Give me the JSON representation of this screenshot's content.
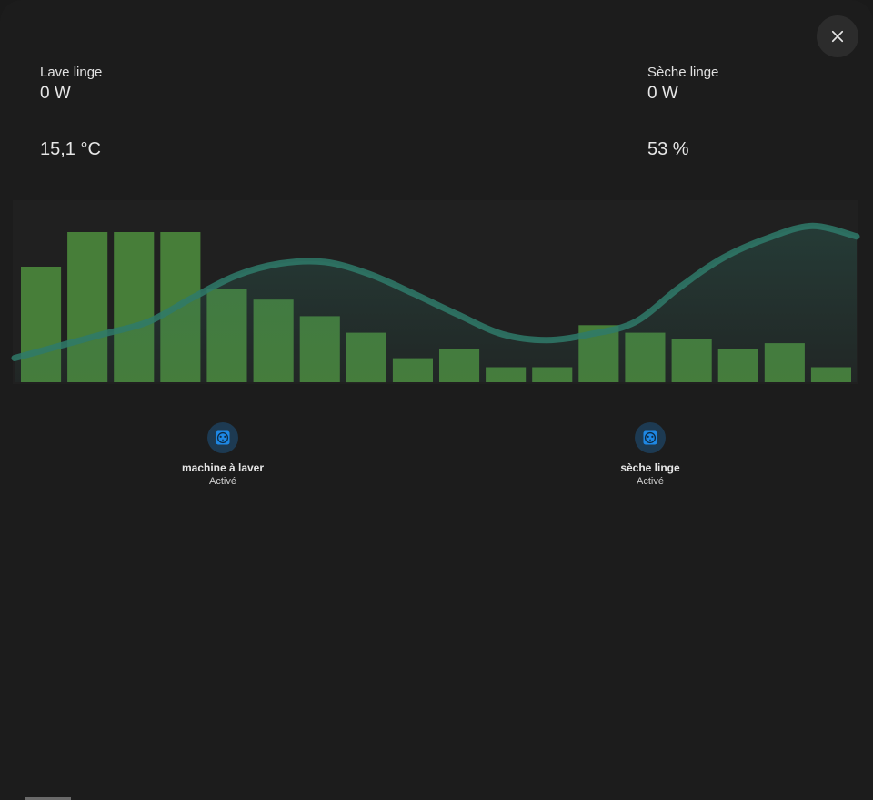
{
  "dialog": {
    "close_icon": "close-icon"
  },
  "sensors": {
    "left": {
      "name": "Lave linge",
      "value": "0 W",
      "secondary": "15,1 °C"
    },
    "right": {
      "name": "Sèche linge",
      "value": "0 W",
      "secondary": "53 %"
    }
  },
  "chart_data": {
    "type": "bar",
    "bar_color": "#4f8f3e",
    "line_color": "#2f7a6a",
    "bars": [
      0.77,
      1.0,
      1.0,
      1.0,
      0.62,
      0.55,
      0.44,
      0.33,
      0.16,
      0.22,
      0.1,
      0.1,
      0.38,
      0.33,
      0.29,
      0.22,
      0.26,
      0.1
    ],
    "line": [
      0.1,
      0.18,
      0.26,
      0.34,
      0.5,
      0.65,
      0.73,
      0.74,
      0.66,
      0.53,
      0.39,
      0.26,
      0.22,
      0.26,
      0.34,
      0.57,
      0.77,
      0.9,
      0.98,
      0.91
    ]
  },
  "devices": [
    {
      "name": "machine à laver",
      "state": "Activé",
      "icon": "power-socket-icon"
    },
    {
      "name": "sèche linge",
      "state": "Activé",
      "icon": "power-socket-icon"
    }
  ]
}
